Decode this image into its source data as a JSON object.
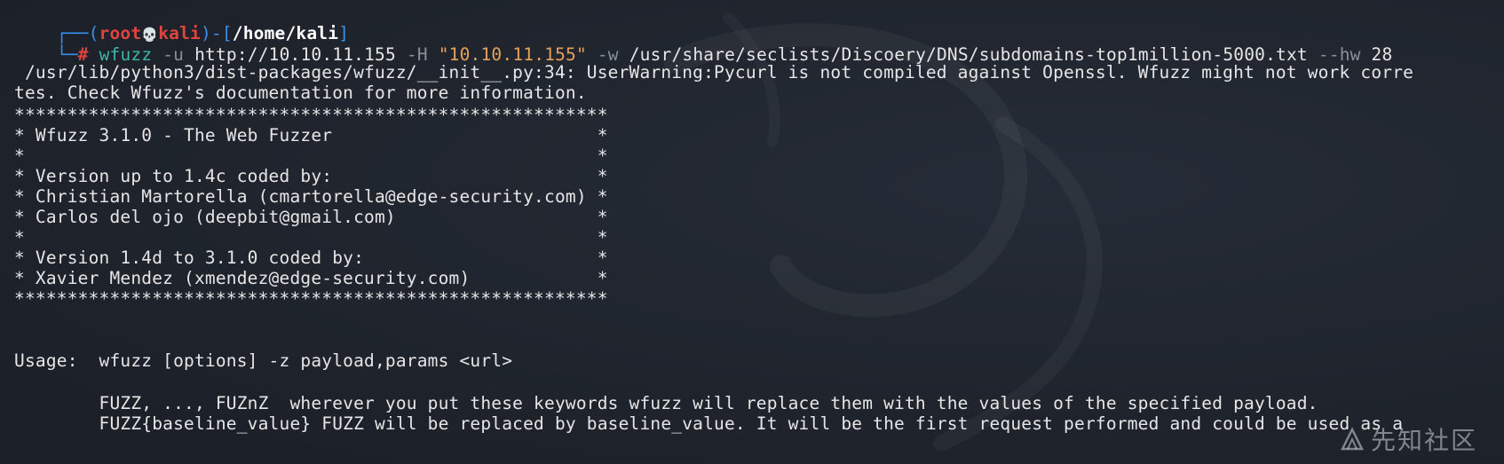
{
  "prompt": {
    "user": "root",
    "skull": "💀",
    "host": "kali",
    "path": "/home/kali",
    "symbol": "#"
  },
  "command": {
    "program": "wfuzz",
    "flag_u": "-u",
    "url": "http://10.10.11.155",
    "flag_H": "-H",
    "header_value": "\"10.10.11.155\"",
    "flag_w": "-w",
    "wordlist": "/usr/share/seclists/Discoery/DNS/subdomains-top1million-5000.txt",
    "flag_hw": "--hw",
    "hw_value": "28"
  },
  "output": {
    "warning_line1": " /usr/lib/python3/dist-packages/wfuzz/__init__.py:34: UserWarning:Pycurl is not compiled against Openssl. Wfuzz might not work corre",
    "warning_line2": "tes. Check Wfuzz's documentation for more information.",
    "banner": [
      "********************************************************",
      "* Wfuzz 3.1.0 - The Web Fuzzer                         *",
      "*                                                      *",
      "* Version up to 1.4c coded by:                         *",
      "* Christian Martorella (cmartorella@edge-security.com) *",
      "* Carlos del ojo (deepbit@gmail.com)                   *",
      "*                                                      *",
      "* Version 1.4d to 3.1.0 coded by:                      *",
      "* Xavier Mendez (xmendez@edge-security.com)            *",
      "********************************************************"
    ],
    "usage": "Usage:  wfuzz [options] -z payload,params <url>",
    "usage_detail1": "        FUZZ, ..., FUZnZ  wherever you put these keywords wfuzz will replace them with the values of the specified payload.",
    "usage_detail2": "        FUZZ{baseline_value} FUZZ will be replaced by baseline_value. It will be the first request performed and could be used as a"
  },
  "watermark": {
    "text": "先知社区"
  }
}
